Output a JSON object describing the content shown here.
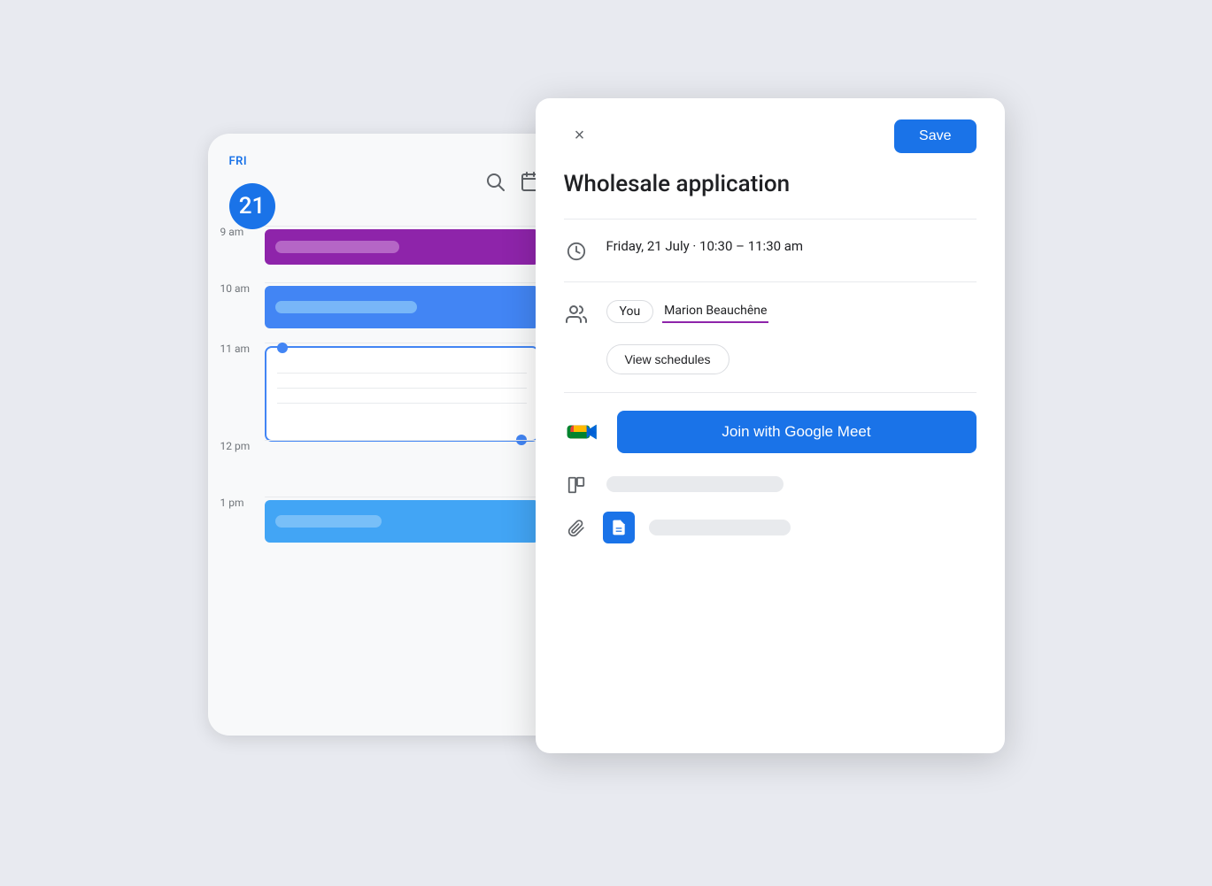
{
  "calendar": {
    "day_label": "FRI",
    "day_number": "21",
    "times": [
      "9 am",
      "10 am",
      "11 am",
      "12 pm",
      "1 pm"
    ],
    "search_icon": "search",
    "calendar_icon": "calendar",
    "purple_event_color": "#8e24aa",
    "blue_event_color": "#4285f4"
  },
  "detail": {
    "close_label": "×",
    "save_label": "Save",
    "event_title": "Wholesale application",
    "date_time": "Friday, 21 July  ·  10:30 – 11:30 am",
    "attendees": [
      "You",
      "Marion Beauchêne"
    ],
    "view_schedules_label": "View schedules",
    "meet_button_label": "Join with Google Meet",
    "divider1": "",
    "divider2": "",
    "divider3": ""
  }
}
